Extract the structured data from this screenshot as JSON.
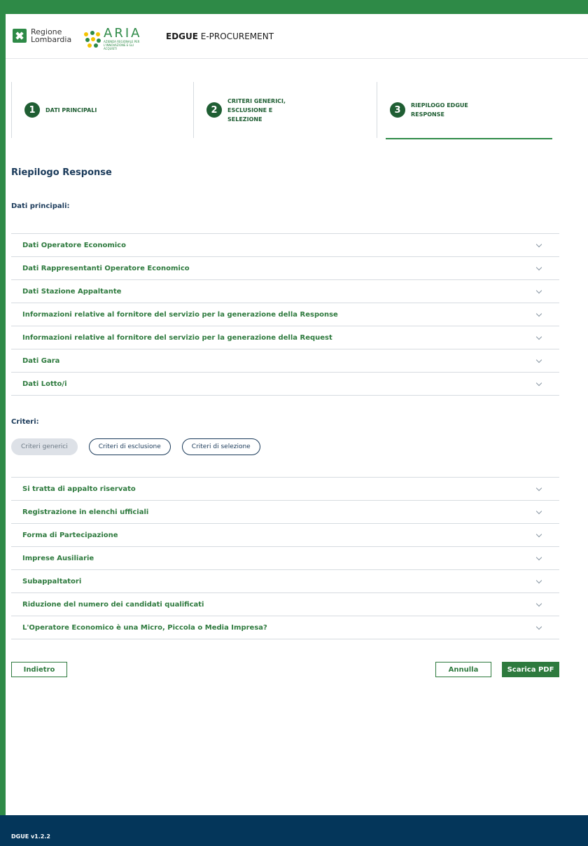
{
  "header": {
    "region_logo_line1": "Regione",
    "region_logo_line2": "Lombardia",
    "aria_logo": "ARIA",
    "aria_logo_sub": "AZIENDA REGIONALE PER L'INNOVAZIONE E GLI ACQUISTI",
    "app_title_bold": "EDGUE",
    "app_title_rest": " E-PROCUREMENT",
    "brand_green": "#2e8a47"
  },
  "stepper": {
    "steps": [
      {
        "num": "1",
        "label": "DATI PRINCIPALI"
      },
      {
        "num": "2",
        "label": "CRITERI GENERICI, ESCLUSIONE E SELEZIONE"
      },
      {
        "num": "3",
        "label": "RIEPILOGO EDGUE RESPONSE"
      }
    ],
    "active_step": 3
  },
  "main": {
    "title": "Riepilogo Response",
    "dati_principali_heading": "Dati principali:",
    "dati_principali_items": [
      "Dati Operatore Economico",
      "Dati Rappresentanti Operatore Economico",
      "Dati Stazione Appaltante",
      "Informazioni relative al fornitore del servizio per la generazione della Response",
      "Informazioni relative al fornitore del servizio per la generazione della Request",
      "Dati Gara",
      "Dati Lotto/i"
    ],
    "criteri_heading": "Criteri:",
    "criteri_filters": [
      "Criteri generici",
      "Criteri di esclusione",
      "Criteri di selezione"
    ],
    "criteri_active_filter": "Criteri generici",
    "criteri_items": [
      "Si tratta di appalto riservato",
      "Registrazione in elenchi ufficiali",
      "Forma di Partecipazione",
      "Imprese Ausiliarie",
      "Subappaltatori",
      "Riduzione del numero dei candidati qualificati",
      "L'Operatore Economico è una Micro, Piccola o Media Impresa?"
    ]
  },
  "actions": {
    "back": "Indietro",
    "cancel": "Annulla",
    "download_pdf": "Scarica PDF"
  },
  "footer": {
    "version": "DGUE v1.2.2",
    "color": "#04365a"
  }
}
